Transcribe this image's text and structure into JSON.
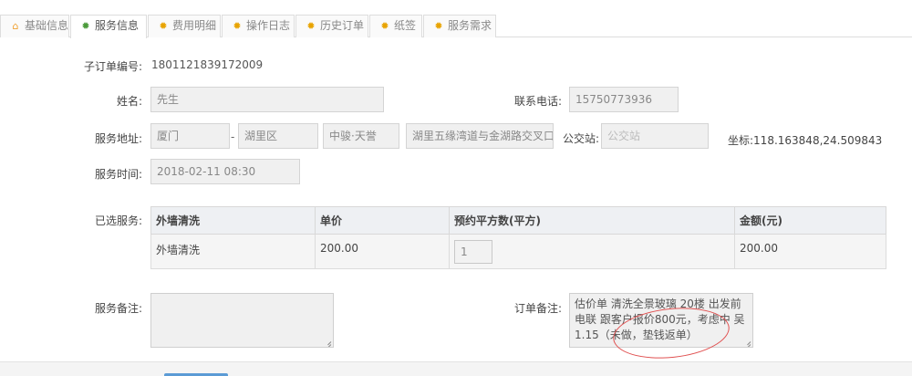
{
  "tabs": [
    {
      "label": "基础信息",
      "icon": "home-icon",
      "active": false
    },
    {
      "label": "服务信息",
      "icon": "gear-icon",
      "active": true
    },
    {
      "label": "费用明细",
      "icon": "gear-icon",
      "active": false
    },
    {
      "label": "操作日志",
      "icon": "gear-icon",
      "active": false
    },
    {
      "label": "历史订单",
      "icon": "gear-icon",
      "active": false
    },
    {
      "label": "纸签",
      "icon": "gear-icon",
      "active": false
    },
    {
      "label": "服务需求",
      "icon": "gear-icon",
      "active": false
    }
  ],
  "order": {
    "sub_order_label": "子订单编号:",
    "sub_order_no": "1801121839172009"
  },
  "customer": {
    "name_label": "姓名:",
    "name": "先生",
    "phone_label": "联系电话:",
    "phone": "15750773936"
  },
  "address": {
    "label": "服务地址:",
    "city": "厦门",
    "separator": "-",
    "district": "湖里区",
    "area": "中骏·天誉",
    "street": "湖里五缘湾道与金湖路交叉口",
    "bus_label": "公交站:",
    "bus_placeholder": "公交站",
    "coord_label": "坐标:",
    "coord_value": "118.163848,24.509843"
  },
  "service_time": {
    "label": "服务时间:",
    "value": "2018-02-11 08:30"
  },
  "selected_services": {
    "label": "已选服务:",
    "headers": [
      "外墙清洗",
      "单价",
      "预约平方数(平方)",
      "金额(元)"
    ],
    "rows": [
      {
        "name": "外墙清洗",
        "price": "200.00",
        "qty": "1",
        "amount": "200.00"
      }
    ]
  },
  "notes": {
    "service_label": "服务备注:",
    "service_value": "",
    "order_label": "订单备注:",
    "order_value": "估价单  清洗全景玻璃 20楼 出发前电联 跟客户报价800元，考虑中 吴 1.15（未做，垫钱返单）"
  },
  "colors": {
    "accent": "#5b9bd5",
    "annotation_circle": "#e05050",
    "tab_gear": "#e8a300",
    "active_tab_gear": "#4a9a3a"
  }
}
